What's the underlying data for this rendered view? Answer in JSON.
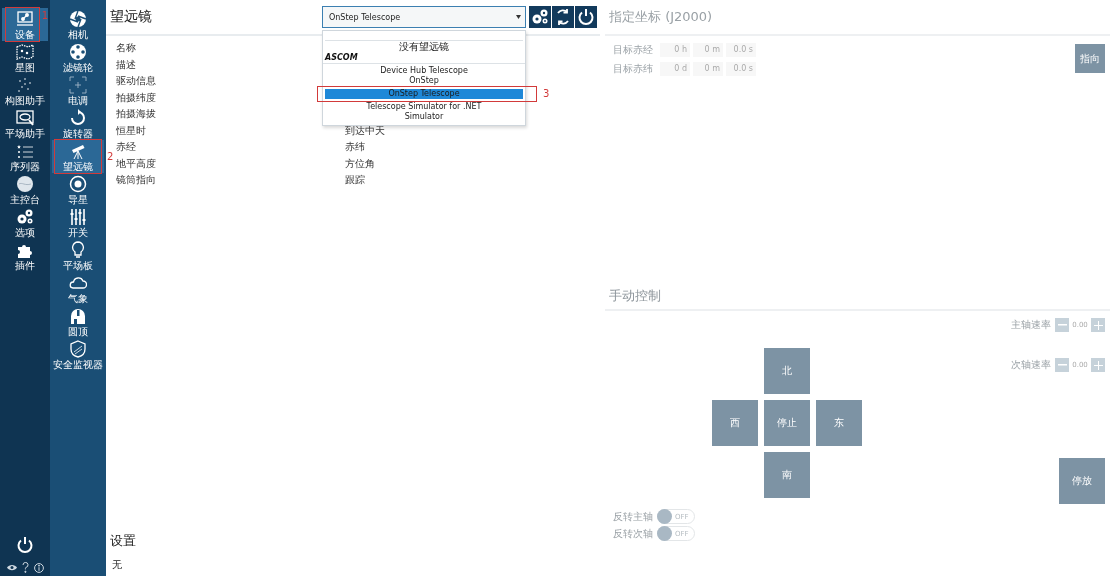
{
  "sidebar": {
    "primary": [
      {
        "label": "设备",
        "selected": true,
        "annotation": "1"
      },
      {
        "label": "星图",
        "selected": false
      },
      {
        "label": "构图助手",
        "selected": false
      },
      {
        "label": "平场助手",
        "selected": false
      },
      {
        "label": "序列器",
        "selected": false
      },
      {
        "label": "主控台",
        "selected": false
      },
      {
        "label": "选项",
        "selected": false
      },
      {
        "label": "插件",
        "selected": false
      }
    ],
    "secondary": [
      {
        "label": "相机",
        "selected": false
      },
      {
        "label": "滤镜轮",
        "selected": false
      },
      {
        "label": "电调",
        "selected": false
      },
      {
        "label": "旋转器",
        "selected": false
      },
      {
        "label": "望远镜",
        "selected": true,
        "annotation": "2"
      },
      {
        "label": "导星",
        "selected": false
      },
      {
        "label": "开关",
        "selected": false
      },
      {
        "label": "平场板",
        "selected": false
      },
      {
        "label": "气象",
        "selected": false
      },
      {
        "label": "圆顶",
        "selected": false
      },
      {
        "label": "安全监视器",
        "selected": false
      }
    ]
  },
  "telescope": {
    "title": "望远镜",
    "device_select": {
      "value": "OnStep Telescope",
      "expanded": true,
      "options": [
        {
          "kind": "item",
          "label": "没有望远镜",
          "selected": false
        },
        {
          "kind": "group",
          "label": "ASCOM"
        },
        {
          "kind": "item",
          "label": "Device Hub Telescope",
          "selected": false
        },
        {
          "kind": "item",
          "label": "OnStep",
          "selected": false
        },
        {
          "kind": "item",
          "label": "OnStep Telescope",
          "selected": true,
          "annotation": "3"
        },
        {
          "kind": "item",
          "label": "Telescope Simulator for .NET",
          "selected": false
        },
        {
          "kind": "item",
          "label": "Simulator",
          "selected": false
        }
      ]
    },
    "properties": [
      {
        "label": "名称"
      },
      {
        "label": "描述"
      },
      {
        "label": "驱动信息"
      },
      {
        "label": "拍摄纬度"
      },
      {
        "label": "拍摄海拔"
      },
      {
        "label": "恒星时",
        "label_2": "到达中天"
      },
      {
        "label": "赤经",
        "label_2": "赤纬"
      },
      {
        "label": "地平高度",
        "label_2": "方位角"
      },
      {
        "label": "镜筒指向",
        "label_2": "跟踪"
      }
    ],
    "settings": {
      "title": "设置",
      "text": "无"
    }
  },
  "target": {
    "title": "指定坐标 (J2000)",
    "rows": [
      {
        "label": "目标赤经",
        "fields": [
          "0 h",
          "0 m",
          "0.0 s"
        ]
      },
      {
        "label": "目标赤纬",
        "fields": [
          "0 d",
          "0 m",
          "0.0 s"
        ]
      }
    ],
    "slew_button": {
      "label": "指向",
      "disabled": true
    }
  },
  "manual": {
    "title": "手动控制",
    "rates": [
      {
        "label": "主轴速率",
        "value": "0.00"
      },
      {
        "label": "次轴速率",
        "value": "0.00"
      }
    ],
    "directions": {
      "north": "北",
      "west": "西",
      "stop": "停止",
      "east": "东",
      "south": "南",
      "disabled": true
    },
    "park_button": {
      "label": "停放",
      "disabled": true
    },
    "toggles": [
      {
        "label": "反转主轴",
        "on": false,
        "state_text": "OFF"
      },
      {
        "label": "反转次轴",
        "on": false,
        "state_text": "OFF"
      }
    ]
  }
}
